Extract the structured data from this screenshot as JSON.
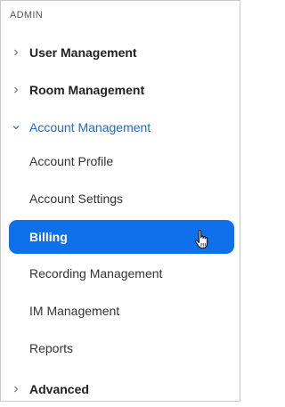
{
  "section": {
    "title": "ADMIN"
  },
  "nav": {
    "user_management": "User Management",
    "room_management": "Room Management",
    "account_management": "Account Management",
    "account_profile": "Account Profile",
    "account_settings": "Account Settings",
    "billing": "Billing",
    "recording_management": "Recording Management",
    "im_management": "IM Management",
    "reports": "Reports",
    "advanced": "Advanced"
  },
  "colors": {
    "accent": "#0e71eb",
    "expanded_text": "#2268d8"
  },
  "icons": {
    "collapsed": "chevron-right-icon",
    "expanded": "chevron-down-icon",
    "pointer": "hand-pointer-icon"
  }
}
